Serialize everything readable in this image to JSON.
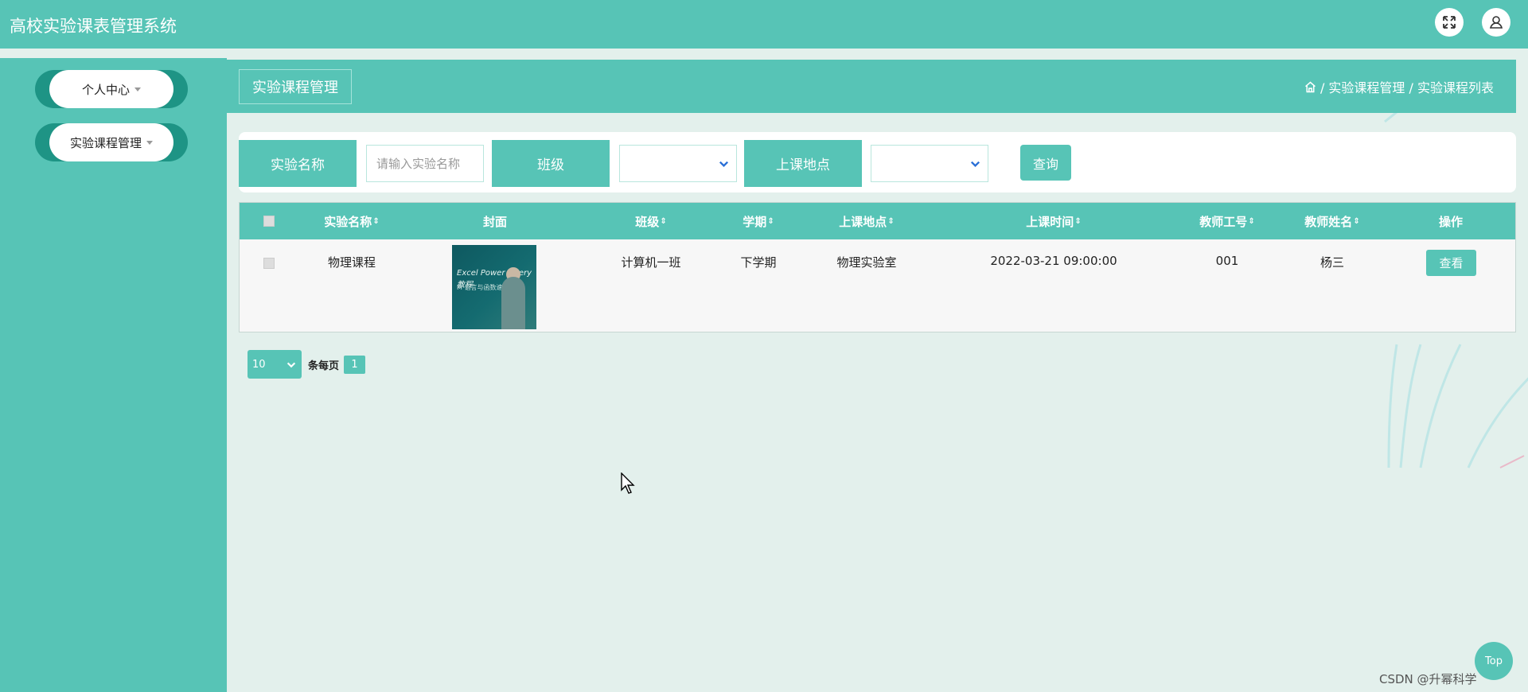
{
  "app": {
    "title": "高校实验课表管理系统"
  },
  "header": {
    "fullscreen_icon": "expand-arrows-icon",
    "user_icon": "user-icon"
  },
  "sidebar": {
    "items": [
      {
        "label": "个人中心"
      },
      {
        "label": "实验课程管理"
      }
    ]
  },
  "page": {
    "title": "实验课程管理",
    "breadcrumb": {
      "home_icon": "home-icon",
      "path": "/ 实验课程管理 / 实验课程列表"
    }
  },
  "search": {
    "name_label": "实验名称",
    "name_placeholder": "请输入实验名称",
    "class_label": "班级",
    "class_value": "",
    "location_label": "上课地点",
    "location_value": "",
    "query_label": "查询"
  },
  "table": {
    "columns": [
      "实验名称",
      "封面",
      "班级",
      "学期",
      "上课地点",
      "上课时间",
      "教师工号",
      "教师姓名",
      "操作"
    ],
    "sort_marker": "⇕",
    "rows": [
      {
        "name": "物理课程",
        "cover_text": "Excel Power Query 教程",
        "cover_subtext": "M 语言与函数速览",
        "class": "计算机一班",
        "term": "下学期",
        "location": "物理实验室",
        "time": "2022-03-21 09:00:00",
        "teacher_id": "001",
        "teacher_name": "杨三",
        "action": "查看"
      }
    ]
  },
  "pagination": {
    "page_size": "10",
    "per_page_label": "条每页",
    "current_page": "1"
  },
  "back_to_top": "Top",
  "watermark": "CSDN @升幂科学",
  "colors": {
    "primary": "#57c4b6",
    "dark_accent": "#1e9485",
    "background": "#e3f0ec"
  }
}
